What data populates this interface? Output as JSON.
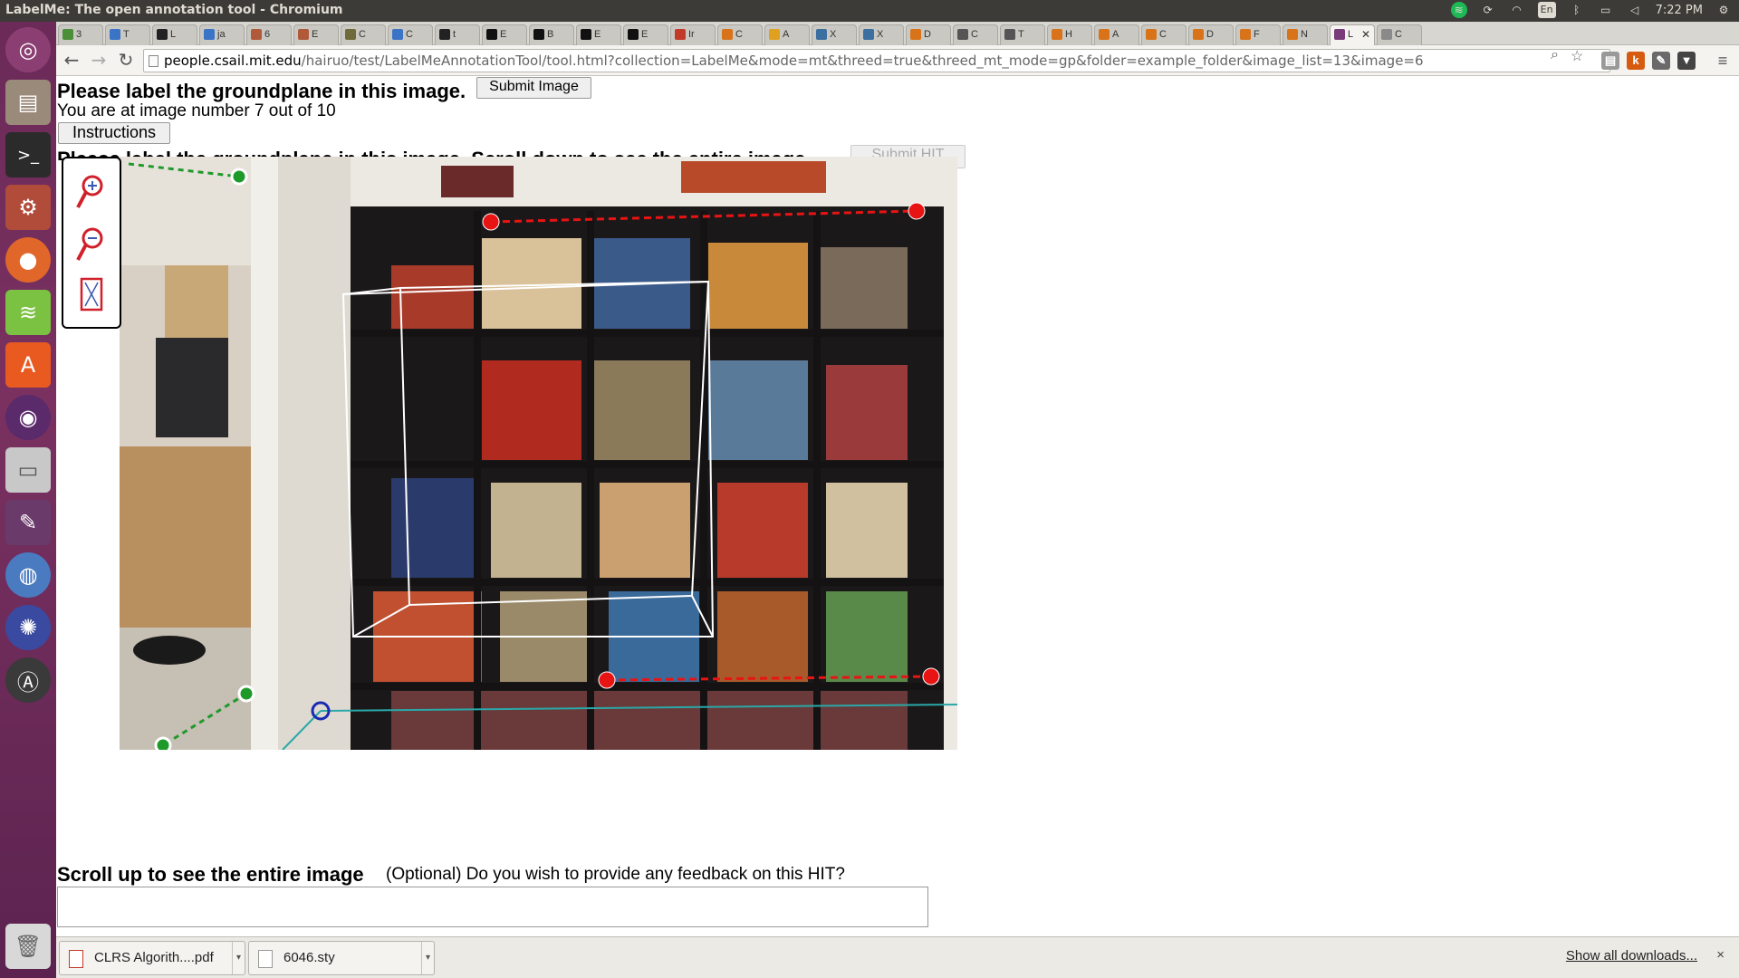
{
  "window": {
    "title": "LabelMe: The open annotation tool - Chromium",
    "clock": "7:22 PM",
    "keyboard_layout": "En"
  },
  "launcher": {
    "items": [
      "ubuntu-logo-icon",
      "files-icon",
      "terminal-icon",
      "settings-icon",
      "firefox-icon",
      "spotify-icon",
      "software-center-icon",
      "app-icon",
      "drive-icon",
      "image-editor-icon",
      "chromium-icon",
      "app2-icon",
      "update-manager-icon",
      "trash-icon"
    ]
  },
  "tabs": [
    {
      "label": "3",
      "color": "#4b8f3a"
    },
    {
      "label": "T",
      "color": "#3b73c7"
    },
    {
      "label": "L",
      "color": "#222222"
    },
    {
      "label": "ja",
      "color": "#3b73c7"
    },
    {
      "label": "6",
      "color": "#b05a3a"
    },
    {
      "label": "E",
      "color": "#b05a3a"
    },
    {
      "label": "C",
      "color": "#6f6a3a"
    },
    {
      "label": "C",
      "color": "#3b73c7"
    },
    {
      "label": "t",
      "color": "#222222"
    },
    {
      "label": "E",
      "color": "#111111"
    },
    {
      "label": "B",
      "color": "#111111"
    },
    {
      "label": "E",
      "color": "#111111"
    },
    {
      "label": "E",
      "color": "#111111"
    },
    {
      "label": "Ir",
      "color": "#c23a2a"
    },
    {
      "label": "C",
      "color": "#d9731a"
    },
    {
      "label": "A",
      "color": "#e0a020"
    },
    {
      "label": "X",
      "color": "#3b6fa0"
    },
    {
      "label": "X",
      "color": "#3b6fa0"
    },
    {
      "label": "D",
      "color": "#d9731a"
    },
    {
      "label": "C",
      "color": "#555555"
    },
    {
      "label": "T",
      "color": "#555555"
    },
    {
      "label": "H",
      "color": "#d9731a"
    },
    {
      "label": "A",
      "color": "#d9731a"
    },
    {
      "label": "C",
      "color": "#d9731a"
    },
    {
      "label": "D",
      "color": "#d9731a"
    },
    {
      "label": "F",
      "color": "#d9731a"
    },
    {
      "label": "N",
      "color": "#d9731a"
    },
    {
      "label": "L",
      "color": "#7a3b7a",
      "active": true
    },
    {
      "label": "C",
      "color": "#8a8a8a"
    }
  ],
  "toolbar": {
    "url_host": "people.csail.mit.edu",
    "url_rest": "/hairuo/test/LabelMeAnnotationTool/tool.html?collection=LabelMe&mode=mt&threed=true&threed_mt_mode=gp&folder=example_folder&image_list=13&image=6"
  },
  "page": {
    "heading": "Please label the groundplane in this image.",
    "submit_image_label": "Submit Image",
    "image_counter": "You are at image number 7 out of 10",
    "instructions_label": "Instructions",
    "heading2": "Please label the groundplane in this image. Scroll down to see the entire image.",
    "submit_hit_label": "Submit HIT",
    "tools": [
      "zoom-in-icon",
      "zoom-out-icon",
      "fit-to-screen-icon"
    ],
    "scroll_up_text": "Scroll up to see the entire image",
    "feedback_question": "(Optional) Do you wish to provide any feedback on this HIT?",
    "feedback_value": ""
  },
  "downloads": {
    "items": [
      {
        "name": "CLRS Algorith....pdf",
        "icon": "pdf-icon"
      },
      {
        "name": "6046.sty",
        "icon": "file-icon"
      }
    ],
    "show_all_label": "Show all downloads...",
    "close_label": "×"
  },
  "colors": {
    "launcher": "#6b2a58",
    "annotation_red": "#e81414",
    "annotation_green": "#1e9a2a",
    "annotation_cyan": "#2aa8a8"
  }
}
